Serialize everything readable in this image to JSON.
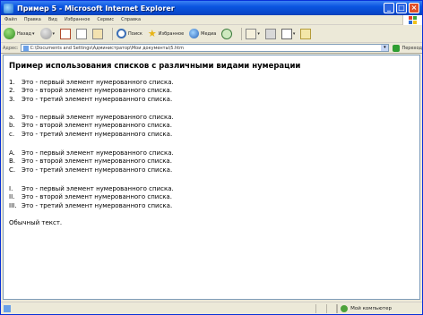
{
  "window": {
    "title": "Пример 5 - Microsoft Internet Explorer"
  },
  "menubar": {
    "items": [
      "Файл",
      "Правка",
      "Вид",
      "Избранное",
      "Сервис",
      "Справка"
    ]
  },
  "toolbar": {
    "back_label": "Назад",
    "search_label": "Поиск",
    "favorites_label": "Избранное",
    "media_label": "Медиа"
  },
  "addressbar": {
    "label": "Адрес:",
    "url": "C:\\Documents and Settings\\Администратор\\Мои документы\\5.htm",
    "go_label": "Переход"
  },
  "content": {
    "heading": "Пример использования списков с различными видами нумерации",
    "lists": [
      {
        "items": [
          {
            "marker": "1.",
            "text": "Это - первый элемент нумерованного списка."
          },
          {
            "marker": "2.",
            "text": "Это - второй элемент нумерованного списка."
          },
          {
            "marker": "3.",
            "text": "Это - третий элемент нумерованного списка."
          }
        ]
      },
      {
        "items": [
          {
            "marker": "a.",
            "text": "Это - первый элемент нумерованного списка."
          },
          {
            "marker": "b.",
            "text": "Это - второй элемент нумерованного списка."
          },
          {
            "marker": "c.",
            "text": "Это - третий элемент нумерованного списка."
          }
        ]
      },
      {
        "items": [
          {
            "marker": "A.",
            "text": "Это - первый элемент нумерованного списка."
          },
          {
            "marker": "B.",
            "text": "Это - второй элемент нумерованного списка."
          },
          {
            "marker": "C.",
            "text": "Это - третий элемент нумерованного списка."
          }
        ]
      },
      {
        "items": [
          {
            "marker": "I.",
            "text": "Это - первый элемент нумерованного списка."
          },
          {
            "marker": "II.",
            "text": "Это - второй элемент нумерованного списка."
          },
          {
            "marker": "III.",
            "text": "Это - третий элемент нумерованного списка."
          }
        ]
      }
    ],
    "plain_text": "Обычный текст."
  },
  "statusbar": {
    "zone_label": "Мой компьютер"
  }
}
